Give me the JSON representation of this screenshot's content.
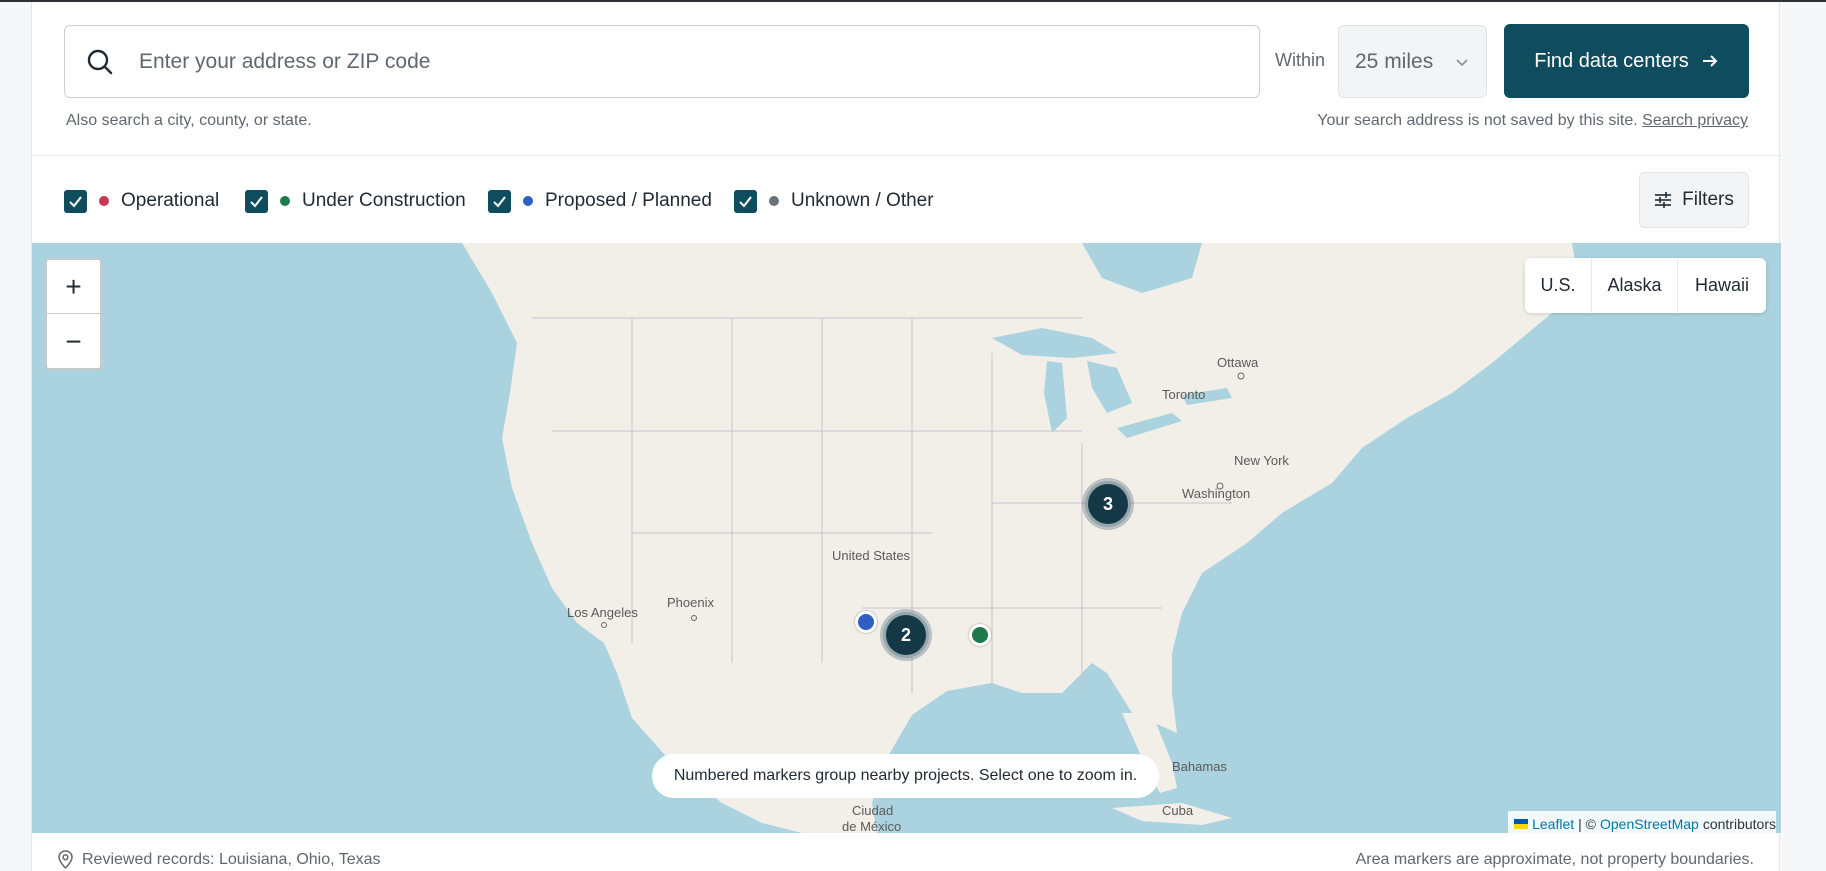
{
  "search": {
    "placeholder": "Enter your address or ZIP code",
    "within_label": "Within",
    "radius_value": "25 miles",
    "submit_label": "Find data centers",
    "help_text": "Also search a city, county, or state.",
    "privacy_note": "Your search address is not saved by this site.",
    "privacy_link": "Search privacy"
  },
  "legend": {
    "items": [
      {
        "label": "Operational",
        "checked": true,
        "color": "#c8384f"
      },
      {
        "label": "Under Construction",
        "checked": true,
        "color": "#1e7a4d"
      },
      {
        "label": "Proposed / Planned",
        "checked": true,
        "color": "#2f5fc4"
      },
      {
        "label": "Unknown / Other",
        "checked": true,
        "color": "#6b7378"
      }
    ],
    "filters_label": "Filters"
  },
  "map": {
    "zoom_in": "+",
    "zoom_out": "−",
    "regions": [
      "U.S.",
      "Alaska",
      "Hawaii"
    ],
    "place_labels": [
      "Ottawa",
      "Toronto",
      "New York",
      "Washington",
      "United States",
      "Phoenix",
      "Los Angeles",
      "Bahamas",
      "Cuba",
      "Ciudad",
      "de México"
    ],
    "clusters": [
      {
        "count": "3"
      },
      {
        "count": "2"
      }
    ],
    "markers": [
      {
        "status": "Proposed / Planned",
        "color": "#2f5fc4"
      },
      {
        "status": "Under Construction",
        "color": "#1e7a4d"
      }
    ],
    "hint": "Numbered markers group nearby projects. Select one to zoom in.",
    "attribution": {
      "leaflet": "Leaflet",
      "separator": "| ©",
      "osm": "OpenStreetMap",
      "suffix": "contributors"
    }
  },
  "footer": {
    "reviewed": "Reviewed records: Louisiana, Ohio, Texas",
    "note": "Area markers are approximate, not property boundaries."
  },
  "colors": {
    "brand": "#0f4d5e",
    "cluster": "#153847",
    "water": "#aad3df",
    "land": "#f2efe9"
  }
}
